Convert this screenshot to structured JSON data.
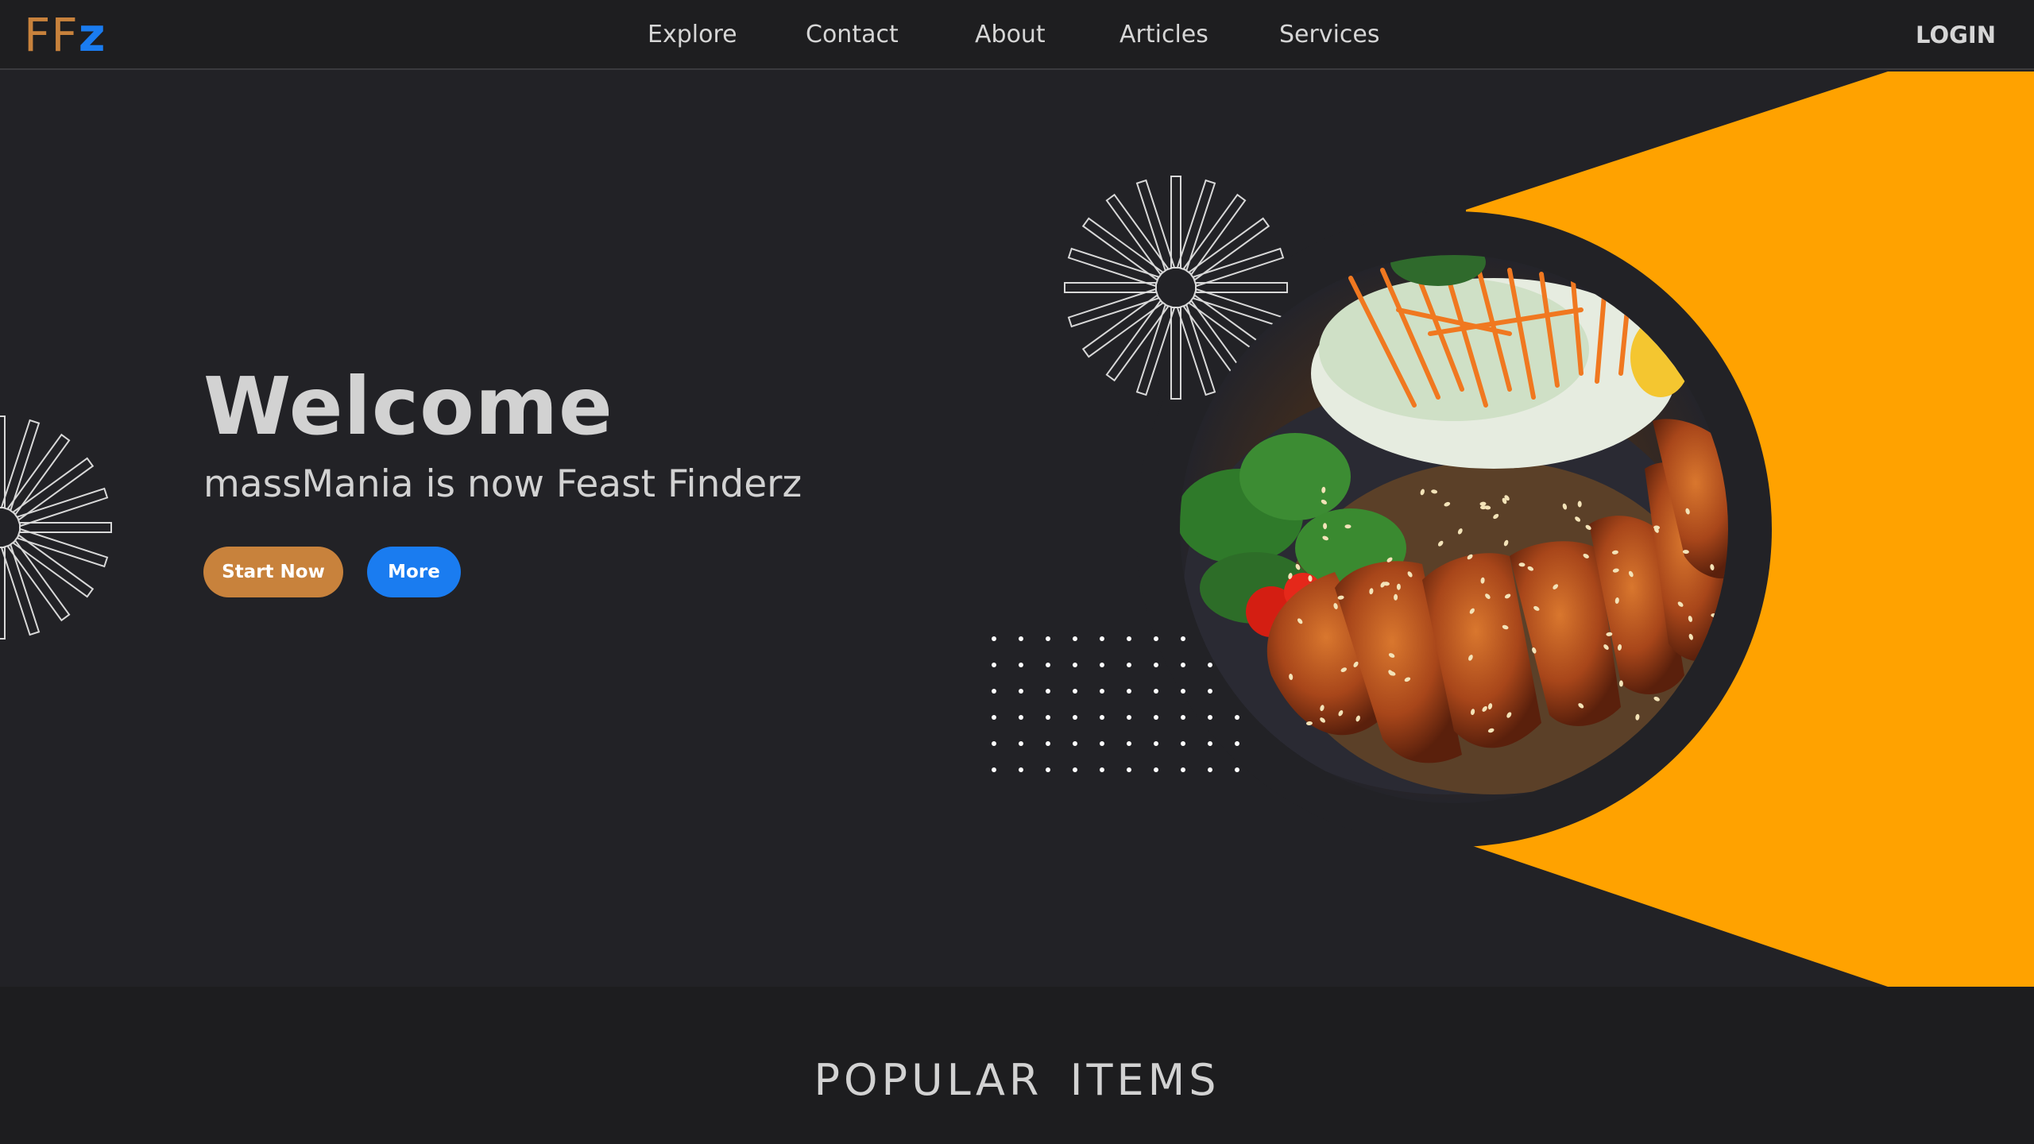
{
  "logo": {
    "part1": "FF",
    "part2": "z"
  },
  "nav": {
    "links": [
      "Explore",
      "Contact",
      "About",
      "Articles",
      "Services"
    ],
    "login": "LOGIN"
  },
  "hero": {
    "title": "Welcome",
    "subtitle": "massMania is now Feast Finderz",
    "buttons": {
      "start": "Start Now",
      "more": "More"
    }
  },
  "popular": {
    "title": "POPULAR ITEMS"
  },
  "colors": {
    "accent_orange": "#ffa200",
    "brand_tan": "#c8823c",
    "brand_blue": "#1a7cf0",
    "background": "#222226"
  },
  "icons": [
    "starburst-decoration",
    "dot-grid-decoration",
    "food-plate-image"
  ]
}
